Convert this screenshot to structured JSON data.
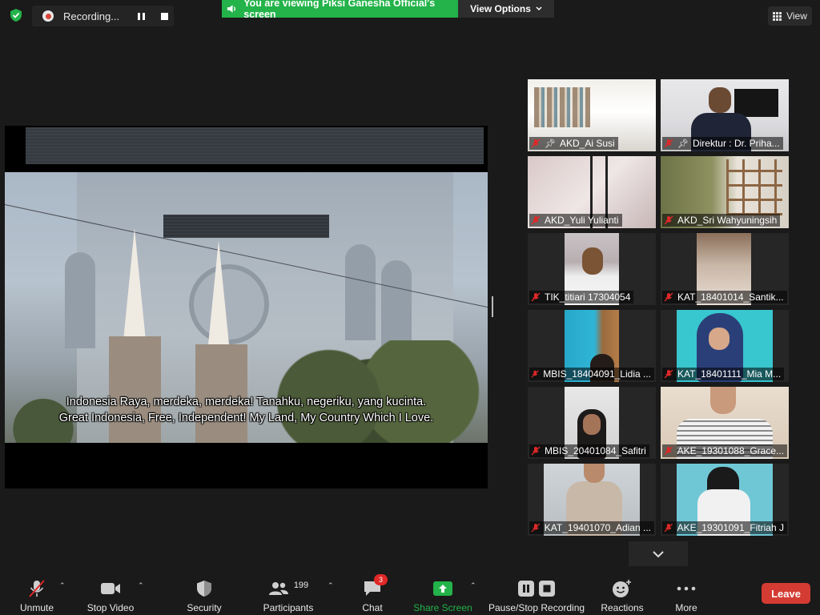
{
  "recording": {
    "label": "Recording..."
  },
  "share_banner": {
    "text": "You are viewing Piksi Ganesha Official's screen"
  },
  "view_options": {
    "label": "View Options"
  },
  "view": {
    "label": "View"
  },
  "shared_video": {
    "subtitle_line1": "Indonesia Raya, merdeka, merdeka! Tanahku, negeriku, yang kucinta.",
    "subtitle_line2": "Great Indonesia, Free, Independent! My Land, My Country Which I Love."
  },
  "participants": [
    {
      "name": "AKD_Ai Susi",
      "pinned": true,
      "muted": true
    },
    {
      "name": "Direktur : Dr. Priha...",
      "pinned": true,
      "muted": true
    },
    {
      "name": "AKD_Yuli Yulianti",
      "pinned": false,
      "muted": true
    },
    {
      "name": "AKD_Sri Wahyuningsih",
      "pinned": false,
      "muted": true
    },
    {
      "name": "TIK_titiari 17304054",
      "pinned": false,
      "muted": true
    },
    {
      "name": "KAT_18401014_Santik...",
      "pinned": false,
      "muted": true
    },
    {
      "name": "MBIS_18404091_Lidia ...",
      "pinned": false,
      "muted": true
    },
    {
      "name": "KAT_18401111_Mia M...",
      "pinned": false,
      "muted": true
    },
    {
      "name": "MBIS_20401084_Safitri",
      "pinned": false,
      "muted": true
    },
    {
      "name": "AKE_19301088_Grace...",
      "pinned": false,
      "muted": true
    },
    {
      "name": "KAT_19401070_Adian ...",
      "pinned": false,
      "muted": true
    },
    {
      "name": "AKE_19301091_Fitriah J",
      "pinned": false,
      "muted": true
    }
  ],
  "toolbar": {
    "unmute": "Unmute",
    "stop_video": "Stop Video",
    "security": "Security",
    "participants": "Participants",
    "participants_count": "199",
    "chat": "Chat",
    "chat_badge": "3",
    "share_screen": "Share Screen",
    "pause_stop_recording": "Pause/Stop Recording",
    "reactions": "Reactions",
    "more": "More",
    "leave": "Leave"
  },
  "colors": {
    "share_green": "#23b34a",
    "leave_red": "#d43b32",
    "muted_red": "#e02828",
    "background": "#1a1a1a"
  }
}
